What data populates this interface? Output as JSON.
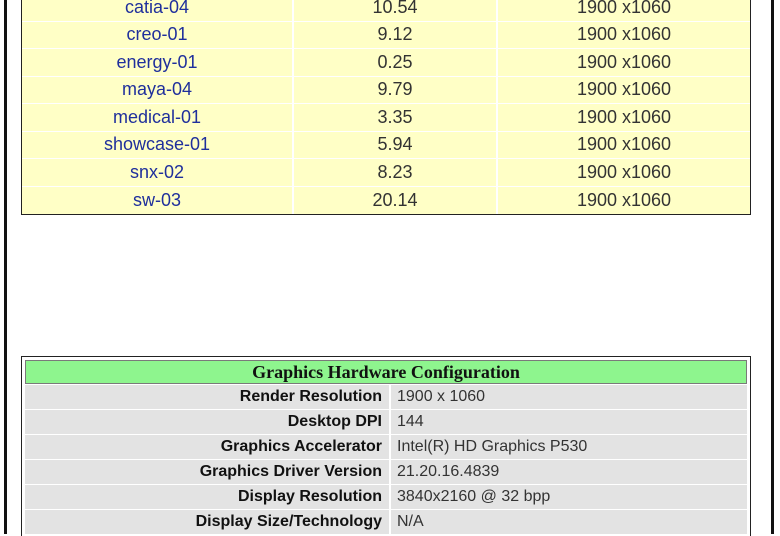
{
  "results": {
    "rows": [
      {
        "name": "catia-04",
        "score": "10.54",
        "resolution": "1900 x1060"
      },
      {
        "name": "creo-01",
        "score": "9.12",
        "resolution": "1900 x1060"
      },
      {
        "name": "energy-01",
        "score": "0.25",
        "resolution": "1900 x1060"
      },
      {
        "name": "maya-04",
        "score": "9.79",
        "resolution": "1900 x1060"
      },
      {
        "name": "medical-01",
        "score": "3.35",
        "resolution": "1900 x1060"
      },
      {
        "name": "showcase-01",
        "score": "5.94",
        "resolution": "1900 x1060"
      },
      {
        "name": "snx-02",
        "score": "8.23",
        "resolution": "1900 x1060"
      },
      {
        "name": "sw-03",
        "score": "20.14",
        "resolution": "1900 x1060"
      }
    ]
  },
  "hardware": {
    "title": "Graphics Hardware Configuration",
    "rows": [
      {
        "label": "Render Resolution",
        "value": "1900 x 1060"
      },
      {
        "label": "Desktop DPI",
        "value": "144"
      },
      {
        "label": "Graphics Accelerator",
        "value": "Intel(R) HD Graphics P530"
      },
      {
        "label": "Graphics Driver Version",
        "value": "21.20.16.4839"
      },
      {
        "label": "Display Resolution",
        "value": "3840x2160 @ 32 bpp"
      },
      {
        "label": "Display Size/Technology",
        "value": "N/A"
      }
    ]
  },
  "colors": {
    "result_bg": "#ffffc6",
    "link_text": "#1f2f9c",
    "header_green": "#8ef58e",
    "row_gray": "#e3e3e3"
  }
}
